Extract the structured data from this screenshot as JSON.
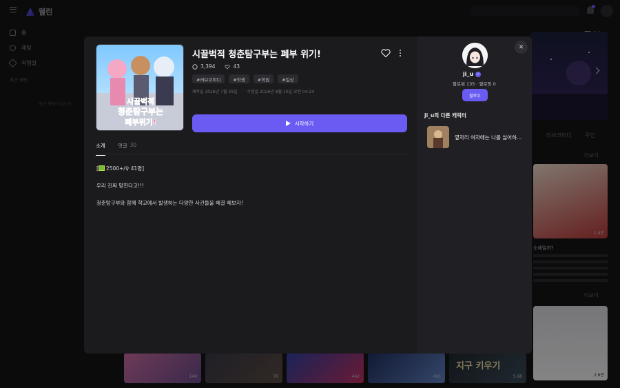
{
  "app": {
    "brand": "웰린"
  },
  "nav": {
    "items": [
      {
        "label": "홈",
        "icon": "home-icon"
      },
      {
        "label": "채팅",
        "icon": "chat-icon"
      },
      {
        "label": "작업실",
        "icon": "tools-icon"
      }
    ],
    "section": "최근 채팅",
    "empty": "최근 채팅이 없어요"
  },
  "background": {
    "tags": [
      "러브코미디",
      "주인"
    ],
    "more_label": "더보기",
    "card_title": "소애일까?",
    "card_counts": [
      "1.4만",
      "2.6만"
    ],
    "strip_counts": [
      "148",
      "76",
      "442",
      "495",
      "5.98"
    ],
    "strip_text": "지구 키우기"
  },
  "character": {
    "title": "시끌벅적 청춘탐구부는 폐부 위기!",
    "chat_count": "3,394",
    "like_count": "43",
    "tags": [
      "#러브코미디",
      "#학생",
      "#학원",
      "#일상"
    ],
    "created": "제작일 2026년 7월 29일",
    "updated": "수정일 2026년 8월 10일 오전 04:24",
    "start_label": "시작하기",
    "cover_caption_1": "시끌벅적",
    "cover_caption_2": "청춘탐구부는",
    "cover_caption_3": "폐부위기!"
  },
  "tabs": [
    {
      "label": "소개",
      "active": true
    },
    {
      "label": "댓글",
      "count": "30",
      "active": false
    }
  ],
  "description": {
    "line1": "2500+/♀ 41명]",
    "line2": "우리 진짜 망한다고!!!",
    "line3": "청춘탐구부와 함께 학교에서 발생하는 다양한 사건들을 해결 해보자!"
  },
  "creator": {
    "name": "ji_u",
    "follow_stats": "팔로워 135 · 팔로잉 0",
    "follow_label": "팔로우",
    "other_heading": "ji_u의 다른 캐릭터",
    "other_title": "옆자리 여자애는 나를 싫어하..."
  },
  "colors": {
    "accent": "#6a5cf2",
    "modal_bg": "#1b1b1e",
    "panel_bg": "#202024"
  }
}
